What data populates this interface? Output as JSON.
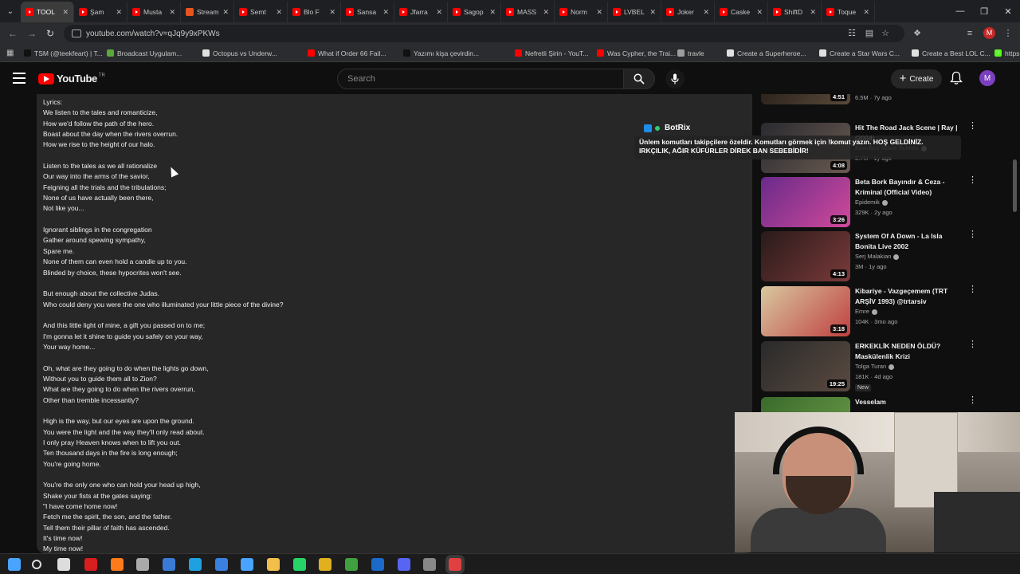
{
  "browser": {
    "tabs": [
      {
        "label": "TOOL",
        "active": true
      },
      {
        "label": "Şam"
      },
      {
        "label": "Musta"
      },
      {
        "label": "Stream",
        "icon": "orange"
      },
      {
        "label": "Semt"
      },
      {
        "label": "Blo F"
      },
      {
        "label": "Sansa"
      },
      {
        "label": "Jfarra"
      },
      {
        "label": "Sagop"
      },
      {
        "label": "MASS"
      },
      {
        "label": "Norm"
      },
      {
        "label": "LVBEL"
      },
      {
        "label": "Joker"
      },
      {
        "label": "Caske"
      },
      {
        "label": "ShiftD"
      },
      {
        "label": "Toque"
      }
    ],
    "url": "youtube.com/watch?v=qJq9y9xPKWs",
    "profile_initial": "M",
    "bookmarks": [
      {
        "label": "TSM (@teekfeart) | T...",
        "color": "#111111"
      },
      {
        "label": "Broadcast Uygulam...",
        "color": "#5aa83b"
      },
      {
        "label": "Octopus vs Underw...",
        "color": "#e0e0e0"
      },
      {
        "label": "What if Order 66 Fail...",
        "color": "#ff0000"
      },
      {
        "label": "Yazımı kişa çevirdin...",
        "color": "#111111"
      },
      {
        "label": "Nefretli Şirin - YouT...",
        "color": "#ff0000"
      },
      {
        "label": "Was Cypher, the Trai...",
        "color": "#ff0000"
      },
      {
        "label": "travle",
        "color": "#9e9e9e"
      },
      {
        "label": "Create a Superheroe...",
        "color": "#e0e0e0"
      },
      {
        "label": "Create a Star Wars C...",
        "color": "#e0e0e0"
      },
      {
        "label": "Create a Best LOL C...",
        "color": "#e0e0e0"
      },
      {
        "label": "https://kick.com/m...",
        "color": "#53fc18"
      }
    ]
  },
  "youtube": {
    "logo_text": "YouTube",
    "region": "TR",
    "search_placeholder": "Search",
    "create_label": "Create",
    "avatar_initial": "M"
  },
  "description": {
    "lines": [
      "Lyrics:",
      "We listen to the tales and romanticize,",
      "How we'd follow the path of the hero.",
      "Boast about the day when the rivers overrun.",
      "How we rise to the height of our halo.",
      "",
      "Listen to the tales as we all rationalize",
      "Our way into the arms of the savior,",
      "Feigning all the trials and the tribulations;",
      "None of us have actually been there,",
      "Not like you...",
      "",
      "Ignorant siblings in the congregation",
      "Gather around spewing sympathy,",
      "Spare me.",
      "None of them can even hold a candle up to you.",
      "Blinded by choice, these hypocrites won't see.",
      "",
      "But enough about the collective Judas.",
      "Who could deny you were the one who illuminated your little piece of the divine?",
      "",
      "And this little light of mine, a gift you passed on to me;",
      "I'm gonna let it shine to guide you safely on your way,",
      "Your way home...",
      "",
      "Oh, what are they going to do when the lights go down,",
      "Without you to guide them all to Zion?",
      "What are they going to do when the rivers overrun,",
      "Other than tremble incessantly?",
      "",
      "High is the way, but our eyes are upon the ground.",
      "You were the light and the way they'll only read about.",
      "I only pray Heaven knows when to lift you out.",
      "Ten thousand days in the fire is long enough;",
      "You're going home.",
      "",
      "You're the only one who can hold your head up high,",
      "Shake your fists at the gates saying:",
      "\"I have come home now!",
      "Fetch me the spirit, the son, and the father.",
      "Tell them their pillar of faith has ascended.",
      "It's time now!",
      "My time now!"
    ]
  },
  "recommendations": [
    {
      "title": "",
      "channel": "",
      "meta": "6.5M · 7y ago",
      "duration": "4:51",
      "colors": [
        "#1a1410",
        "#5a4a3a"
      ]
    },
    {
      "title": "Hit The Road Jack Scene | Ray | (2004)",
      "channel": "Boxoffice Movie Scenes",
      "meta": "2.7M · 1y ago",
      "duration": "4:08",
      "colors": [
        "#2a2a30",
        "#6a5a50"
      ]
    },
    {
      "title": "Beta Bork Bayındır & Ceza - Kriminal (Official Video)",
      "channel": "Epidemik",
      "meta": "329K · 2y ago",
      "duration": "3:26",
      "colors": [
        "#6a2a8a",
        "#d04a9a"
      ]
    },
    {
      "title": "System Of A Down - La Isla Bonita Live 2002",
      "channel": "Serj Malakian",
      "meta": "3M · 1y ago",
      "duration": "4:13",
      "colors": [
        "#2a1a1a",
        "#7a3a3a"
      ]
    },
    {
      "title": "Kibariye - Vazgeçemem (TRT ARŞİV 1993) @trtarsiv",
      "channel": "Emre",
      "meta": "104K · 3mo ago",
      "duration": "3:18",
      "colors": [
        "#d8c8a0",
        "#c04040"
      ]
    },
    {
      "title": "ERKEKLİK NEDEN ÖLDÜ? Maskülenlik Krizi",
      "channel": "Tolga Turan",
      "meta": "181K · 4d ago",
      "duration": "19:25",
      "badge": "New",
      "colors": [
        "#2a2a2a",
        "#5a4a40"
      ]
    },
    {
      "title": "Vesselam",
      "channel": "",
      "meta": "",
      "duration": "",
      "colors": [
        "#3a6a2a",
        "#6a9a4a"
      ]
    }
  ],
  "chat_overlay": {
    "username": "BotRix",
    "message": "Ünlem komutları takipçilere özeldir. Komutları görmek için !komut yazın. HOŞ GELDİNİZ. IRKÇILIK, AĞIR KÜFÜRLER DİREK BAN SEBEBİDİR!"
  },
  "taskbar": {
    "icons": [
      {
        "name": "windows-start-icon",
        "color": "#4aa3ff"
      },
      {
        "name": "search-icon",
        "color": "#dddddd"
      },
      {
        "name": "task-view-icon",
        "color": "#dddddd"
      },
      {
        "name": "opera-icon",
        "color": "#d81e1e"
      },
      {
        "name": "firefox-icon",
        "color": "#ff7a1a"
      },
      {
        "name": "app-icon",
        "color": "#aaaaaa"
      },
      {
        "name": "store-icon",
        "color": "#3a7bd5"
      },
      {
        "name": "edge-icon",
        "color": "#1fa0e0"
      },
      {
        "name": "app-blue-icon",
        "color": "#3a80e0"
      },
      {
        "name": "app-blue2-icon",
        "color": "#4aa3ff"
      },
      {
        "name": "folder-icon",
        "color": "#f2c04a"
      },
      {
        "name": "whatsapp-icon",
        "color": "#25d366"
      },
      {
        "name": "chrome-icon",
        "color": "#e0b020"
      },
      {
        "name": "chrome2-icon",
        "color": "#40a040"
      },
      {
        "name": "steam-icon",
        "color": "#1b6ac9"
      },
      {
        "name": "discord-icon",
        "color": "#5865f2"
      },
      {
        "name": "app-grey-icon",
        "color": "#888888"
      },
      {
        "name": "chrome-active-icon",
        "color": "#e04040"
      }
    ]
  }
}
